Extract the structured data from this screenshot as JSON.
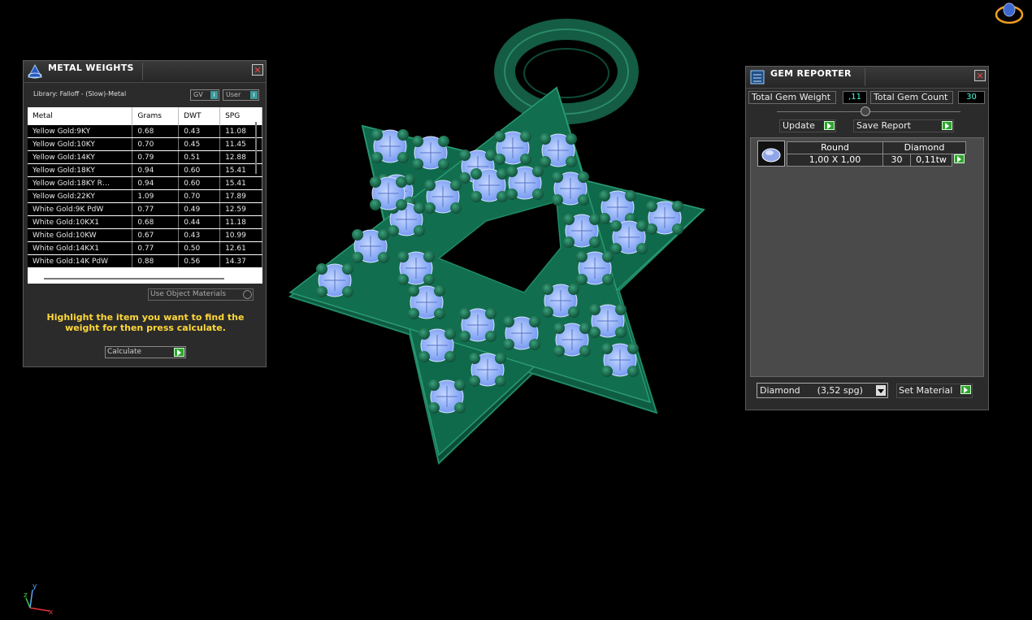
{
  "metal_weights": {
    "title": "METAL WEIGHTS",
    "library": "Library: Falloff - (Slow)-Metal",
    "toggle_gv": "GV",
    "toggle_user": "User",
    "columns": [
      "Metal",
      "Grams",
      "DWT",
      "SPG"
    ],
    "rows": [
      [
        "Yellow Gold:9KY",
        "0.68",
        "0.43",
        "11.08"
      ],
      [
        "Yellow Gold:10KY",
        "0.70",
        "0.45",
        "11.45"
      ],
      [
        "Yellow Gold:14KY",
        "0.79",
        "0.51",
        "12.88"
      ],
      [
        "Yellow Gold:18KY",
        "0.94",
        "0.60",
        "15.41"
      ],
      [
        "Yellow Gold:18KY R…",
        "0.94",
        "0.60",
        "15.41"
      ],
      [
        "Yellow Gold:22KY",
        "1.09",
        "0.70",
        "17.89"
      ],
      [
        "White Gold:9K PdW",
        "0.77",
        "0.49",
        "12.59"
      ],
      [
        "White Gold:10KX1",
        "0.68",
        "0.44",
        "11.18"
      ],
      [
        "White Gold:10KW",
        "0.67",
        "0.43",
        "10.99"
      ],
      [
        "White Gold:14KX1",
        "0.77",
        "0.50",
        "12.61"
      ],
      [
        "White Gold:14K PdW",
        "0.88",
        "0.56",
        "14.37"
      ]
    ],
    "use_object_materials": "Use Object Materials",
    "hint": "Highlight the item you want to find the weight for then press calculate.",
    "calculate": "Calculate"
  },
  "gem_reporter": {
    "title": "GEM REPORTER",
    "total_gem_weight_label": "Total Gem Weight",
    "total_gem_weight_value": ",11",
    "total_gem_count_label": "Total Gem Count",
    "total_gem_count_value": "30",
    "update": "Update",
    "save_report": "Save Report",
    "gem": {
      "shape": "Round",
      "material": "Diamond",
      "size": "1,00 X 1,00",
      "count": "30",
      "weight": "0,11tw"
    },
    "material_select": "Diamond      (3,52 spg)",
    "set_material": "Set Material"
  },
  "axes": {
    "x": "x",
    "y": "y",
    "z": "z"
  },
  "colors": {
    "model": "#0e6e4e",
    "gems": "#8fb4ff",
    "hint": "#ffd83a",
    "go_button": "#2fa52f"
  }
}
